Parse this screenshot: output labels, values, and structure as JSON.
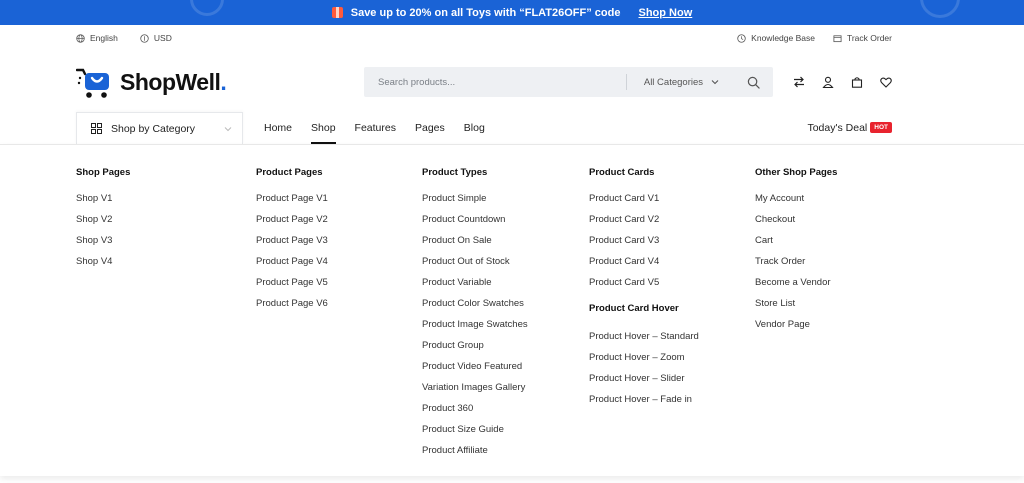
{
  "promo": {
    "text": "Save up to 20% on all Toys with “FLAT26OFF” code",
    "link": "Shop Now"
  },
  "topbar": {
    "language": "English",
    "currency": "USD",
    "knowledge_base": "Knowledge Base",
    "track_order": "Track Order"
  },
  "header": {
    "logo_text": "ShopWell",
    "logo_dot": ".",
    "search_placeholder": "Search products...",
    "category_select": "All Categories"
  },
  "nav": {
    "shop_by_category": "Shop by Category",
    "links": [
      "Home",
      "Shop",
      "Features",
      "Pages",
      "Blog"
    ],
    "active": "Shop",
    "deal": "Today's Deal",
    "hot_badge": "HOT"
  },
  "mega_menu": {
    "shop_pages": {
      "title": "Shop Pages",
      "items": [
        "Shop V1",
        "Shop V2",
        "Shop V3",
        "Shop V4"
      ]
    },
    "product_pages": {
      "title": "Product Pages",
      "items": [
        "Product Page V1",
        "Product Page V2",
        "Product Page V3",
        "Product Page V4",
        "Product Page V5",
        "Product Page V6"
      ]
    },
    "product_types": {
      "title": "Product Types",
      "items": [
        "Product Simple",
        "Product Countdown",
        "Product On Sale",
        "Product Out of Stock",
        "Product Variable",
        "Product Color Swatches",
        "Product Image Swatches",
        "Product Group",
        "Product Video Featured",
        "Variation Images Gallery",
        "Product 360",
        "Product Size Guide",
        "Product Affiliate"
      ]
    },
    "product_cards": {
      "title": "Product Cards",
      "items": [
        "Product Card V1",
        "Product Card V2",
        "Product Card V3",
        "Product Card V4",
        "Product Card V5"
      ],
      "hover_title": "Product Card Hover",
      "hover_items": [
        "Product Hover – Standard",
        "Product Hover – Zoom",
        "Product Hover – Slider",
        "Product Hover – Fade in"
      ]
    },
    "other_shop_pages": {
      "title": "Other Shop Pages",
      "items": [
        "My Account",
        "Checkout",
        "Cart",
        "Track Order",
        "Become a Vendor",
        "Store List",
        "Vendor Page"
      ]
    }
  },
  "colors": {
    "brand_blue": "#1a63d6",
    "hot_red": "#e8232e"
  }
}
